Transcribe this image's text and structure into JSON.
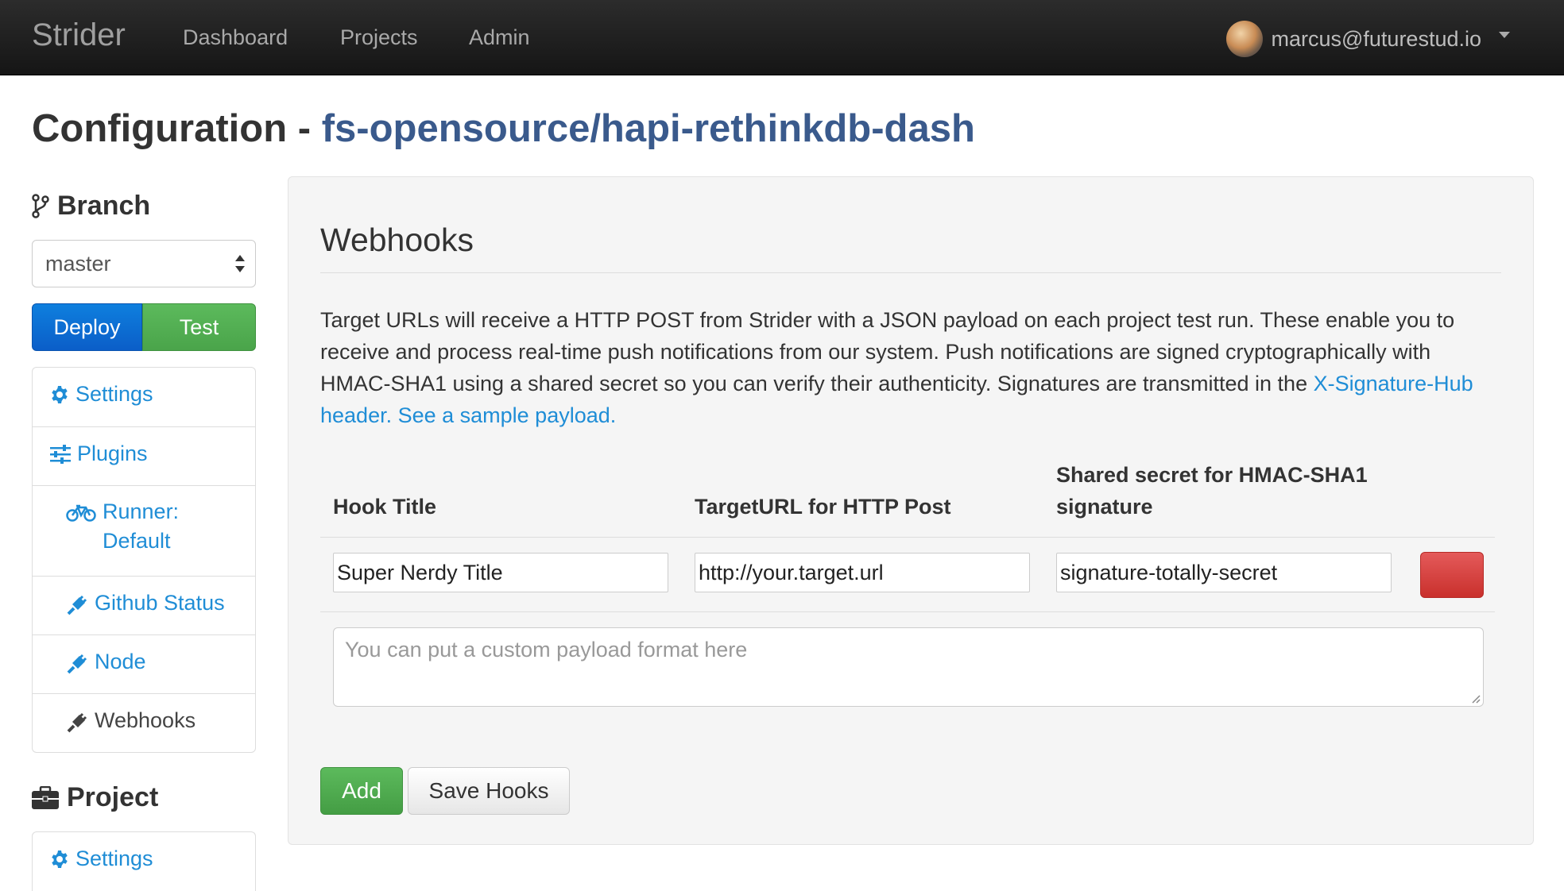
{
  "navbar": {
    "brand": "Strider",
    "links": [
      "Dashboard",
      "Projects",
      "Admin"
    ],
    "user_email": "marcus@futurestud.io"
  },
  "page": {
    "title_prefix": "Configuration - ",
    "repo": "fs-opensource/hapi-rethinkdb-dash"
  },
  "sidebar": {
    "branch_heading": "Branch",
    "branch_value": "master",
    "deploy_label": "Deploy",
    "test_label": "Test",
    "branch_items": [
      {
        "label": "Settings",
        "icon": "gear-icon"
      },
      {
        "label": "Plugins",
        "icon": "sliders-icon"
      },
      {
        "label": "Runner: Default",
        "icon": "bicycle-icon"
      },
      {
        "label": "Github Status",
        "icon": "plug-icon"
      },
      {
        "label": "Node",
        "icon": "plug-icon"
      },
      {
        "label": "Webhooks",
        "icon": "plug-icon"
      }
    ],
    "project_heading": "Project",
    "project_items": [
      {
        "label": "Settings",
        "icon": "gear-icon"
      }
    ]
  },
  "webhooks": {
    "title": "Webhooks",
    "description_text": "Target URLs will receive a HTTP POST from Strider with a JSON payload on each project test run. These enable you to receive and process real-time push notifications from our system. Push notifications are signed cryptographically with HMAC-SHA1 using a shared secret so you can verify their authenticity. Signatures are transmitted in the ",
    "description_link": "X-Signature-Hub header. See a sample payload.",
    "columns": [
      "Hook Title",
      "TargetURL for HTTP Post",
      "Shared secret for HMAC-SHA1 signature"
    ],
    "hooks": [
      {
        "title": "Super Nerdy Title",
        "url": "http://your.target.url",
        "secret": "signature-totally-secret",
        "payload_placeholder": "You can put a custom payload format here"
      }
    ],
    "add_label": "Add",
    "save_label": "Save Hooks"
  }
}
